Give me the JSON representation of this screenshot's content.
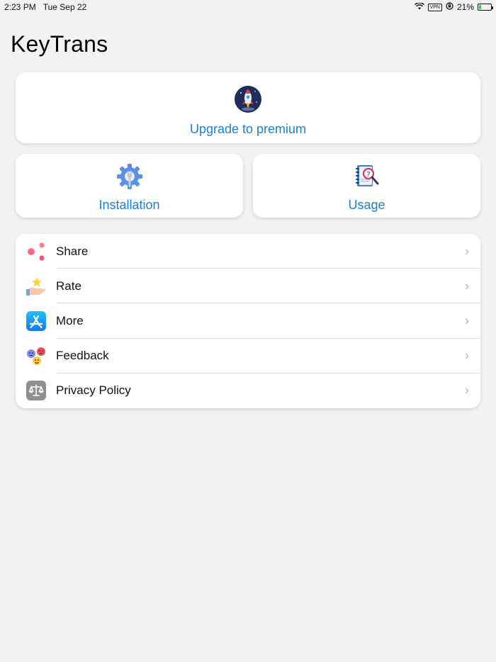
{
  "status_bar": {
    "time": "2:23 PM",
    "date": "Tue Sep 22",
    "vpn": "VPN",
    "battery": "21%",
    "battery_level": 0.21
  },
  "app": {
    "title": "KeyTrans"
  },
  "cards": {
    "premium": {
      "label": "Upgrade to premium",
      "icon": "rocket-icon"
    },
    "installation": {
      "label": "Installation",
      "icon": "gear-wrench-icon"
    },
    "usage": {
      "label": "Usage",
      "icon": "notebook-search-icon"
    }
  },
  "menu": {
    "items": [
      {
        "label": "Share",
        "icon": "share-icon"
      },
      {
        "label": "Rate",
        "icon": "rate-star-hand-icon"
      },
      {
        "label": "More",
        "icon": "app-store-icon"
      },
      {
        "label": "Feedback",
        "icon": "feedback-emoji-icon"
      },
      {
        "label": "Privacy Policy",
        "icon": "scales-icon"
      }
    ],
    "chevron": "›"
  },
  "colors": {
    "accent": "#1a7fd6",
    "background": "#f2f2f2",
    "card": "#ffffff"
  }
}
